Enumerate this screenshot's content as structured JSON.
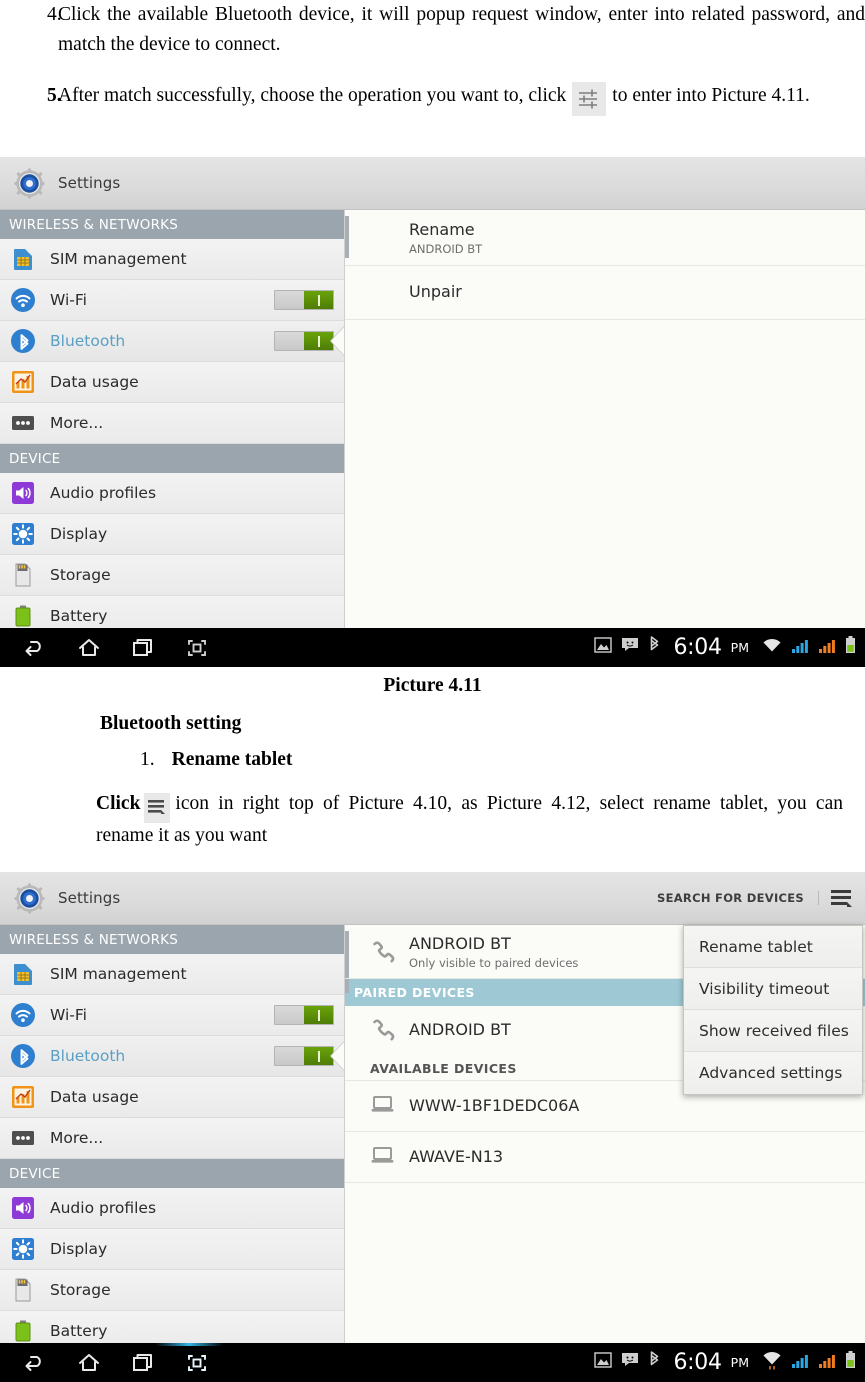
{
  "document": {
    "steps": [
      {
        "number": "4.",
        "text": "Click the available Bluetooth device, it will popup request window, enter into related password, and match the device to connect."
      },
      {
        "number": "5.",
        "text_before": "After match successfully, choose the operation you want to, click",
        "icon": "sliders-settings-icon",
        "text_after": "to enter into Picture 4.11."
      }
    ],
    "caption_1": "Picture 4.11",
    "heading_bluetooth_setting": "Bluetooth setting",
    "sub_number": "1.",
    "sub_heading": "Rename tablet",
    "click_paragraph": {
      "lead": "Click",
      "icon": "hamburger-menu-icon",
      "rest": "icon in right top of Picture 4.10, as Picture 4.12, select rename tablet, you can rename it as you want"
    }
  },
  "screenshot_1": {
    "actionbar": {
      "app_icon": "settings-gear-icon",
      "title": "Settings"
    },
    "sidebar": {
      "sections": [
        {
          "header": "WIRELESS & NETWORKS",
          "items": [
            {
              "label": "SIM management",
              "icon": "sim-card-icon",
              "toggle": null,
              "selected": false
            },
            {
              "label": "Wi-Fi",
              "icon": "wifi-icon",
              "toggle": "on",
              "selected": false
            },
            {
              "label": "Bluetooth",
              "icon": "bluetooth-icon",
              "toggle": "on",
              "selected": true
            },
            {
              "label": "Data usage",
              "icon": "data-usage-icon",
              "toggle": null,
              "selected": false
            },
            {
              "label": "More...",
              "icon": "more-dots-icon",
              "toggle": null,
              "selected": false
            }
          ]
        },
        {
          "header": "DEVICE",
          "items": [
            {
              "label": "Audio profiles",
              "icon": "speaker-icon",
              "toggle": null,
              "selected": false
            },
            {
              "label": "Display",
              "icon": "brightness-icon",
              "toggle": null,
              "selected": false
            },
            {
              "label": "Storage",
              "icon": "sd-card-icon",
              "toggle": null,
              "selected": false
            },
            {
              "label": "Battery",
              "icon": "battery-icon",
              "toggle": null,
              "selected": false
            }
          ]
        }
      ]
    },
    "content": {
      "rows": [
        {
          "title": "Rename",
          "subtitle": "ANDROID BT"
        },
        {
          "title": "Unpair",
          "subtitle": ""
        }
      ]
    },
    "navbar": {
      "buttons": [
        "back-icon",
        "home-icon",
        "recents-icon",
        "screenshot-icon"
      ],
      "status_icons": [
        "image-icon",
        "message-icon",
        "bluetooth-icon"
      ],
      "time": "6:04",
      "meridiem": "PM",
      "signal_icons": [
        "wifi-icon",
        "signal-bars-blue-icon",
        "signal-bars-orange-icon",
        "battery-icon"
      ]
    }
  },
  "screenshot_2": {
    "actionbar": {
      "app_icon": "settings-gear-icon",
      "title": "Settings",
      "search_label": "SEARCH FOR DEVICES",
      "overflow_icon": "overflow-menu-icon"
    },
    "sidebar": {
      "sections": [
        {
          "header": "WIRELESS & NETWORKS",
          "items": [
            {
              "label": "SIM management",
              "icon": "sim-card-icon",
              "toggle": null,
              "selected": false
            },
            {
              "label": "Wi-Fi",
              "icon": "wifi-icon",
              "toggle": "on",
              "selected": false
            },
            {
              "label": "Bluetooth",
              "icon": "bluetooth-icon",
              "toggle": "on",
              "selected": true
            },
            {
              "label": "Data usage",
              "icon": "data-usage-icon",
              "toggle": null,
              "selected": false
            },
            {
              "label": "More...",
              "icon": "more-dots-icon",
              "toggle": null,
              "selected": false
            }
          ]
        },
        {
          "header": "DEVICE",
          "items": [
            {
              "label": "Audio profiles",
              "icon": "speaker-icon",
              "toggle": null,
              "selected": false
            },
            {
              "label": "Display",
              "icon": "brightness-icon",
              "toggle": null,
              "selected": false
            },
            {
              "label": "Storage",
              "icon": "sd-card-icon",
              "toggle": null,
              "selected": false
            },
            {
              "label": "Battery",
              "icon": "battery-icon",
              "toggle": null,
              "selected": false
            }
          ]
        }
      ]
    },
    "content": {
      "self_device": {
        "title": "ANDROID BT",
        "subtitle": "Only visible to paired devices",
        "icon": "phone-icon"
      },
      "paired_header": "PAIRED DEVICES",
      "paired_devices": [
        {
          "title": "ANDROID BT",
          "icon": "phone-icon"
        }
      ],
      "available_header": "AVAILABLE DEVICES",
      "available_devices": [
        {
          "title": "WWW-1BF1DEDC06A",
          "icon": "laptop-icon"
        },
        {
          "title": "AWAVE-N13",
          "icon": "laptop-icon"
        }
      ]
    },
    "dropdown": {
      "items": [
        "Rename tablet",
        "Visibility timeout",
        "Show received files",
        "Advanced settings"
      ]
    },
    "navbar": {
      "buttons": [
        "back-icon",
        "home-icon",
        "recents-icon",
        "screenshot-icon"
      ],
      "status_icons": [
        "image-icon",
        "message-icon",
        "bluetooth-icon"
      ],
      "time": "6:04",
      "meridiem": "PM",
      "signal_icons": [
        "wifi-icon",
        "signal-bars-blue-icon",
        "signal-bars-orange-icon",
        "battery-icon"
      ]
    }
  },
  "colors": {
    "section_header_bg": "#9aa5ad",
    "paired_header_bg": "#9ec9d4",
    "toggle_on": "#5d920a",
    "selected_label": "#5a9fc4",
    "navbar_bg": "#000000",
    "accent_blue": "#33b5e5"
  }
}
